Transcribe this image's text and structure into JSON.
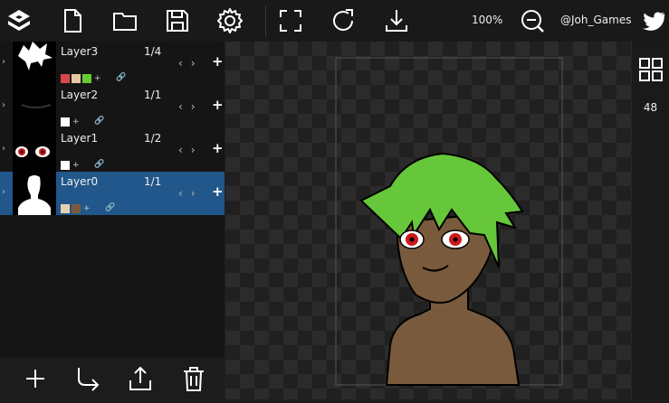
{
  "toolbar": {
    "zoom": "100%",
    "username": "@Joh_Games",
    "icons": [
      "app-logo-icon",
      "new-file-icon",
      "folder-icon",
      "save-icon",
      "settings-icon",
      "fullscreen-icon",
      "redo-icon",
      "download-icon",
      "zoom-icon",
      "twitter-icon"
    ]
  },
  "layers": [
    {
      "name": "Layer3",
      "count": "1/4",
      "selected": false,
      "swatches": [
        "#d84848",
        "#e8c8a0",
        "#66cc33"
      ]
    },
    {
      "name": "Layer2",
      "count": "1/1",
      "selected": false,
      "swatches": [
        "#ffffff"
      ]
    },
    {
      "name": "Layer1",
      "count": "1/2",
      "selected": false,
      "swatches": [
        "#ffffff"
      ]
    },
    {
      "name": "Layer0",
      "count": "1/1",
      "selected": true,
      "swatches": [
        "#e8d0b0",
        "#7a5a3c"
      ]
    }
  ],
  "right_panel": {
    "value": "48"
  },
  "colors": {
    "hair": "#66c73a",
    "skin": "#7a5a3c",
    "eye": "#cc1a1a",
    "accent": "#21578a"
  }
}
